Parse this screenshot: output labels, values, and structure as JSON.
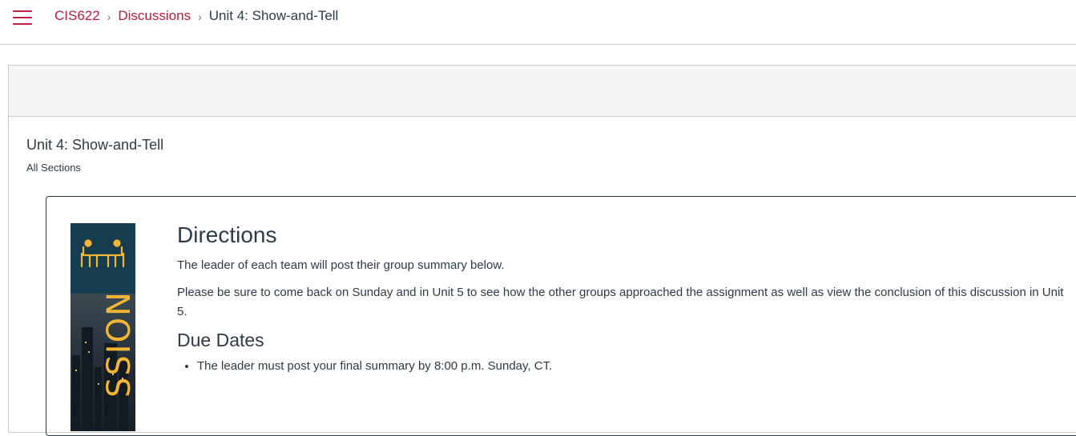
{
  "breadcrumb": {
    "course": "CIS622",
    "section": "Discussions",
    "current": "Unit 4: Show-and-Tell"
  },
  "topic": {
    "title": "Unit 4: Show-and-Tell",
    "sections": "All Sections"
  },
  "banner": {
    "icon": "meeting-table-icon",
    "word": "SSION",
    "accent_color": "#f2b632",
    "top_color": "#153c4f"
  },
  "content": {
    "heading": "Directions",
    "paragraphs": [
      "The leader of each team will post their group summary below.",
      "Please be sure to come back on Sunday and in Unit 5 to see how the other groups approached the assignment as well as view the conclusion of this discussion in Unit 5."
    ],
    "due_heading": "Due Dates",
    "due_items": [
      "The leader must post your final summary by 8:00 p.m. Sunday, CT."
    ]
  },
  "colors": {
    "brand_link": "#b81c3d",
    "text": "#2d3b45"
  }
}
